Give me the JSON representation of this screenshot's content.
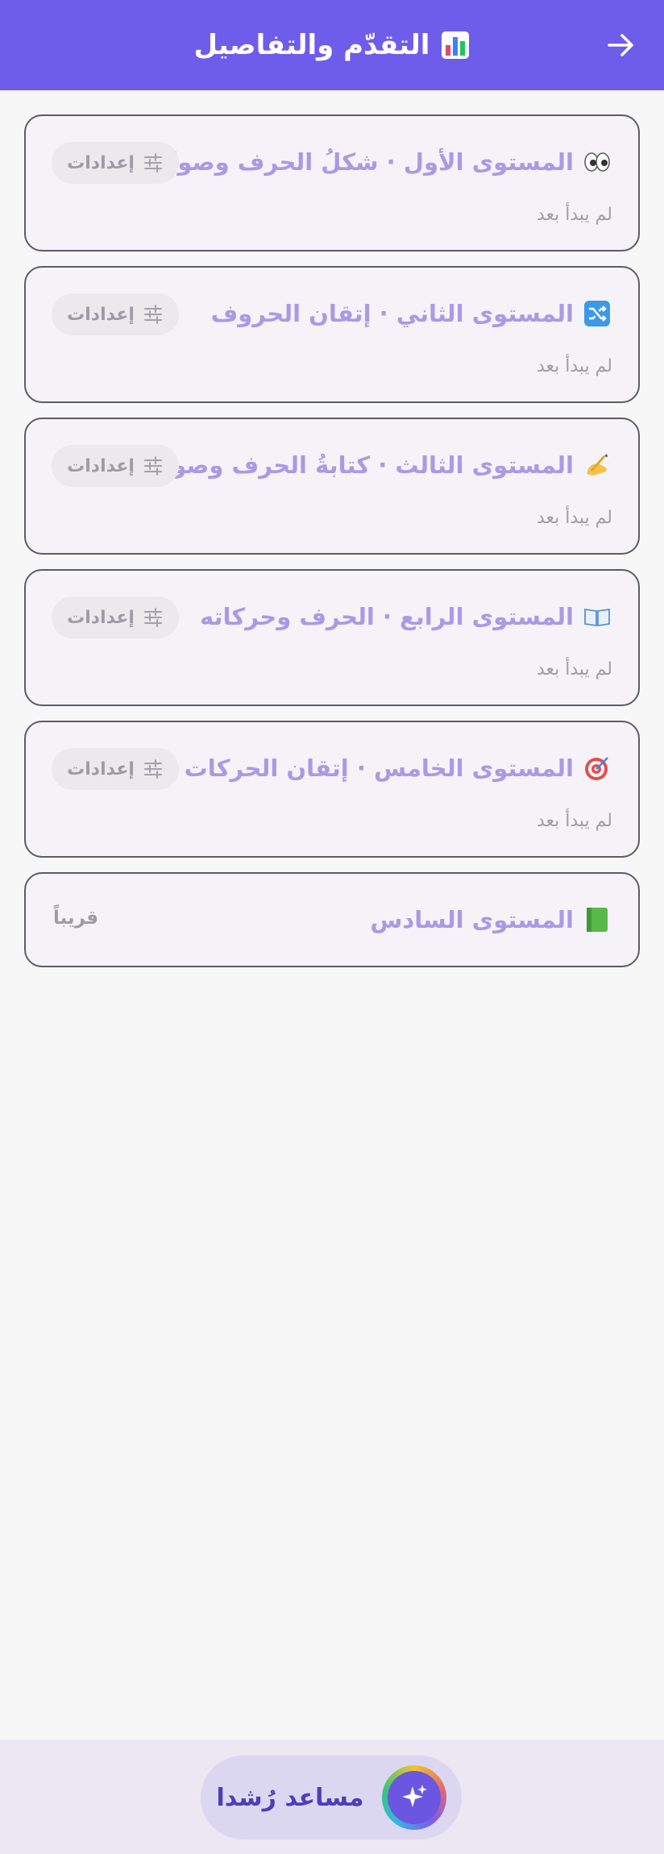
{
  "header": {
    "title": "التقدّم والتفاصيل",
    "icon": "bar-chart-icon",
    "back_icon": "arrow-right-icon",
    "background": "#6e5cea"
  },
  "levels": [
    {
      "title": "المستوى الأول · شكلُ الحرف وصوتُه",
      "emoji": "eyes-icon",
      "status": "لم يبدأ بعد",
      "settings_label": "إعدادات"
    },
    {
      "title": "المستوى الثاني · إتقان الحروف",
      "emoji": "shuffle-icon",
      "status": "لم يبدأ بعد",
      "settings_label": "إعدادات"
    },
    {
      "title": "المستوى الثالث · كتابةُ الحرف وصوتُه",
      "emoji": "writing-hand-icon",
      "status": "لم يبدأ بعد",
      "settings_label": "إعدادات"
    },
    {
      "title": "المستوى الرابع · الحرف وحركاته",
      "emoji": "open-book-icon",
      "status": "لم يبدأ بعد",
      "settings_label": "إعدادات"
    },
    {
      "title": "المستوى الخامس · إتقان الحركات",
      "emoji": "target-icon",
      "status": "لم يبدأ بعد",
      "settings_label": "إعدادات"
    },
    {
      "title": "المستوى السادس",
      "emoji": "green-book-icon",
      "soon_label": "قريباً"
    }
  ],
  "assistant": {
    "label": "مساعد رُشدا",
    "icon": "sparkles-icon"
  },
  "colors": {
    "accent": "#6e5cea",
    "title_text": "#a89be3",
    "muted_text": "#9e9ea6"
  }
}
